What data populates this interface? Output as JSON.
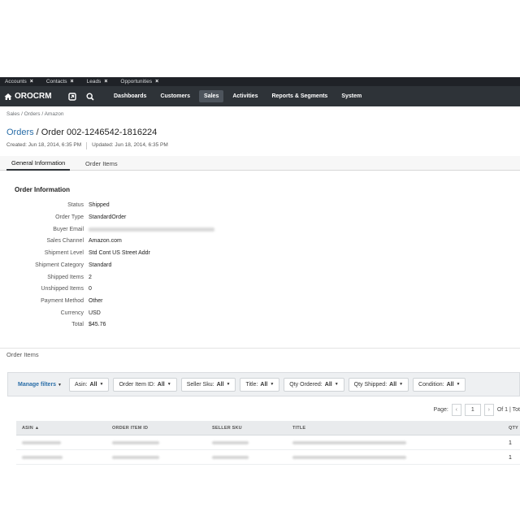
{
  "pinbar": {
    "items": [
      {
        "label": "Accounts"
      },
      {
        "label": "Contacts"
      },
      {
        "label": "Leads"
      },
      {
        "label": "Opportunities"
      }
    ],
    "close_glyph": "×"
  },
  "navbar": {
    "logo_text": "OROCRM",
    "menu": [
      {
        "label": "Dashboards"
      },
      {
        "label": "Customers"
      },
      {
        "label": "Sales",
        "active": true
      },
      {
        "label": "Activities"
      },
      {
        "label": "Reports & Segments"
      },
      {
        "label": "System"
      }
    ]
  },
  "breadcrumb": "Sales / Orders / Amazon",
  "page_title": {
    "parent_link": "Orders",
    "separator": " / ",
    "text": "Order 002-1246542-1816224"
  },
  "meta": {
    "created": "Created: Jun 18, 2014, 6:35 PM",
    "updated": "Updated: Jun 18, 2014, 6:35 PM"
  },
  "tabs": [
    {
      "label": "General Information",
      "active": true
    },
    {
      "label": "Order Items",
      "active": false
    }
  ],
  "order_info": {
    "title": "Order Information",
    "fields": [
      {
        "label": "Status",
        "value": "Shipped"
      },
      {
        "label": "Order Type",
        "value": "StandardOrder"
      },
      {
        "label": "Buyer Email",
        "value": ""
      },
      {
        "label": "Sales Channel",
        "value": "Amazon.com"
      },
      {
        "label": "Shipment Level",
        "value": "Std Cont US Street Addr"
      },
      {
        "label": "Shipment Category",
        "value": "Standard"
      },
      {
        "label": "Shipped Items",
        "value": "2"
      },
      {
        "label": "Unshipped Items",
        "value": "0"
      },
      {
        "label": "Payment Method",
        "value": "Other"
      },
      {
        "label": "Currency",
        "value": "USD"
      },
      {
        "label": "Total",
        "value": "$45.76"
      }
    ]
  },
  "order_items": {
    "section_title": "Order Items",
    "manage_filters": "Manage filters",
    "filters": [
      {
        "label": "Asin:",
        "value": "All"
      },
      {
        "label": "Order Item ID:",
        "value": "All"
      },
      {
        "label": "Seller Sku:",
        "value": "All"
      },
      {
        "label": "Title:",
        "value": "All"
      },
      {
        "label": "Qty Ordered:",
        "value": "All"
      },
      {
        "label": "Qty Shipped:",
        "value": "All"
      },
      {
        "label": "Condition:",
        "value": "All"
      }
    ],
    "pager": {
      "label": "Page:",
      "page": "1",
      "of": "Of 1 | Tot"
    },
    "columns": [
      "ASIN",
      "ORDER ITEM ID",
      "SELLER SKU",
      "TITLE",
      "QTY"
    ],
    "rows": [
      {
        "asin": "",
        "order_item_id": "",
        "seller_sku": "",
        "title": "",
        "qty": "1"
      },
      {
        "asin": "",
        "order_item_id": "",
        "seller_sku": "",
        "title": "",
        "qty": "1"
      }
    ]
  }
}
